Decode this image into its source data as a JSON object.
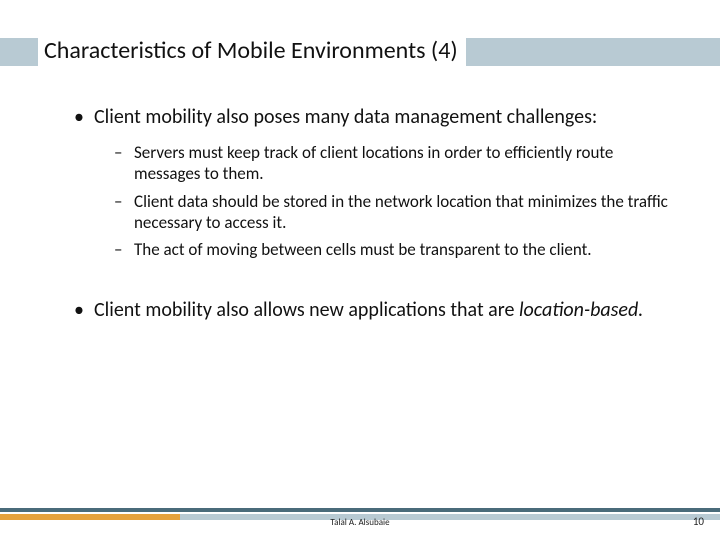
{
  "title": "Characteristics of Mobile Environments (4)",
  "bullets": {
    "b1": "Client mobility also poses many data management challenges:",
    "sub1": "Servers must keep track of client locations in order to efficiently route messages to them.",
    "sub2": "Client data should be stored in the network location that minimizes the traffic necessary to access it.",
    "sub3": "The act of moving between cells must be transparent to the client.",
    "b2_pre": "Client mobility also allows new applications that are ",
    "b2_em": "location-based."
  },
  "footer": {
    "author": "Talal A. Alsubaie",
    "page": "10"
  }
}
